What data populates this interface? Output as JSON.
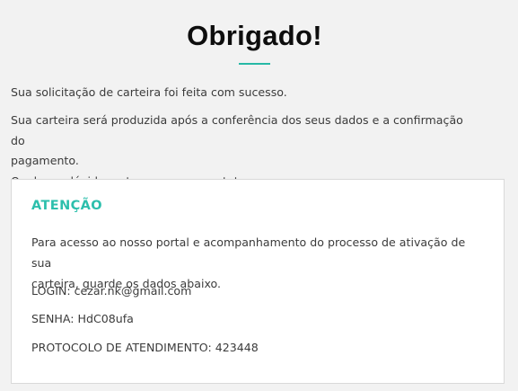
{
  "title": "Obrigado!",
  "messages": {
    "success": "Sua solicitação de carteira foi feita com sucesso.",
    "production_line1": "Sua carteira será produzida após a conferência dos seus dados e a confirmação do",
    "production_line2": "pagamento.",
    "contact": "Qualquer dúvida, entraremos em contato."
  },
  "attention": {
    "heading": "ATENÇÃO",
    "intro_line1": "Para acesso ao nosso portal e acompanhamento do processo de ativação de sua",
    "intro_line2": "carteira, guarde os dados abaixo.",
    "login": "LOGIN: cezar.nk@gmail.com",
    "senha": "SENHA: HdC08ufa",
    "protocolo": "PROTOCOLO DE ATENDIMENTO: 423448"
  },
  "colors": {
    "accent": "#27b9a6",
    "heading_accent": "#2cbfac",
    "background": "#f2f2f2",
    "card_background": "#ffffff",
    "text": "#3b3b3b"
  }
}
